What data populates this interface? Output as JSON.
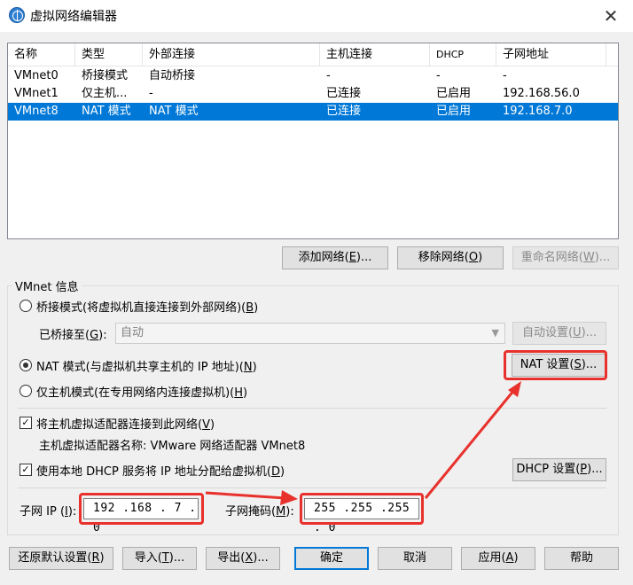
{
  "window": {
    "title": "虚拟网络编辑器",
    "close": "✕"
  },
  "table": {
    "headers": [
      "名称",
      "类型",
      "外部连接",
      "主机连接",
      "DHCP",
      "子网地址"
    ],
    "rows": [
      [
        "VMnet0",
        "桥接模式",
        "自动桥接",
        "-",
        "-",
        "-"
      ],
      [
        "VMnet1",
        "仅主机...",
        "-",
        "已连接",
        "已启用",
        "192.168.56.0"
      ],
      [
        "VMnet8",
        "NAT 模式",
        "NAT 模式",
        "已连接",
        "已启用",
        "192.168.7.0"
      ]
    ],
    "selected_row": 2
  },
  "buttons": {
    "add_network": {
      "text": "添加网络(",
      "key": "E",
      "tail": ")..."
    },
    "remove_network": {
      "text": "移除网络(",
      "key": "O",
      "tail": ")"
    },
    "rename_network": {
      "text": "重命名网络(",
      "key": "W",
      "tail": ")..."
    }
  },
  "vmnet_info": {
    "group_label": "VMnet 信息",
    "bridged": {
      "text": "桥接模式(将虚拟机直接连接到外部网络)(",
      "key": "B",
      "tail": ")"
    },
    "bridged_to": {
      "label": "已桥接至(",
      "key": "G",
      "tail": "):",
      "value": "自动"
    },
    "auto_settings": {
      "text": "自动设置(",
      "key": "U",
      "tail": ")..."
    },
    "nat": {
      "text": "NAT 模式(与虚拟机共享主机的 IP 地址)(",
      "key": "N",
      "tail": ")"
    },
    "nat_settings": {
      "text": "NAT 设置(",
      "key": "S",
      "tail": ")..."
    },
    "host_only": {
      "text": "仅主机模式(在专用网络内连接虚拟机)(",
      "key": "H",
      "tail": ")"
    },
    "connect_adapter": {
      "text": "将主机虚拟适配器连接到此网络(",
      "key": "V",
      "tail": ")"
    },
    "adapter_name": "主机虚拟适配器名称: VMware 网络适配器 VMnet8",
    "use_dhcp": {
      "text": "使用本地 DHCP 服务将 IP 地址分配给虚拟机(",
      "key": "D",
      "tail": ")"
    },
    "dhcp_settings": {
      "text": "DHCP 设置(",
      "key": "P",
      "tail": ")..."
    },
    "subnet_ip": {
      "label": "子网 IP (",
      "key": "I",
      "tail": "):",
      "value": "192 .168 . 7 . 0"
    },
    "subnet_mask": {
      "label": "子网掩码(",
      "key": "M",
      "tail": "):",
      "value": "255 .255 .255 . 0"
    }
  },
  "bottom_buttons": {
    "restore_defaults": {
      "text": "还原默认设置(",
      "key": "R",
      "tail": ")"
    },
    "import": {
      "text": "导入(",
      "key": "T",
      "tail": ")..."
    },
    "export": {
      "text": "导出(",
      "key": "X",
      "tail": ")..."
    },
    "ok": {
      "text": "确定"
    },
    "cancel": {
      "text": "取消"
    },
    "apply": {
      "text": "应用(",
      "key": "A",
      "tail": ")"
    },
    "help": {
      "text": "帮助"
    }
  },
  "colors": {
    "selection": "#0078d7",
    "annotation_red": "#e8312c"
  }
}
